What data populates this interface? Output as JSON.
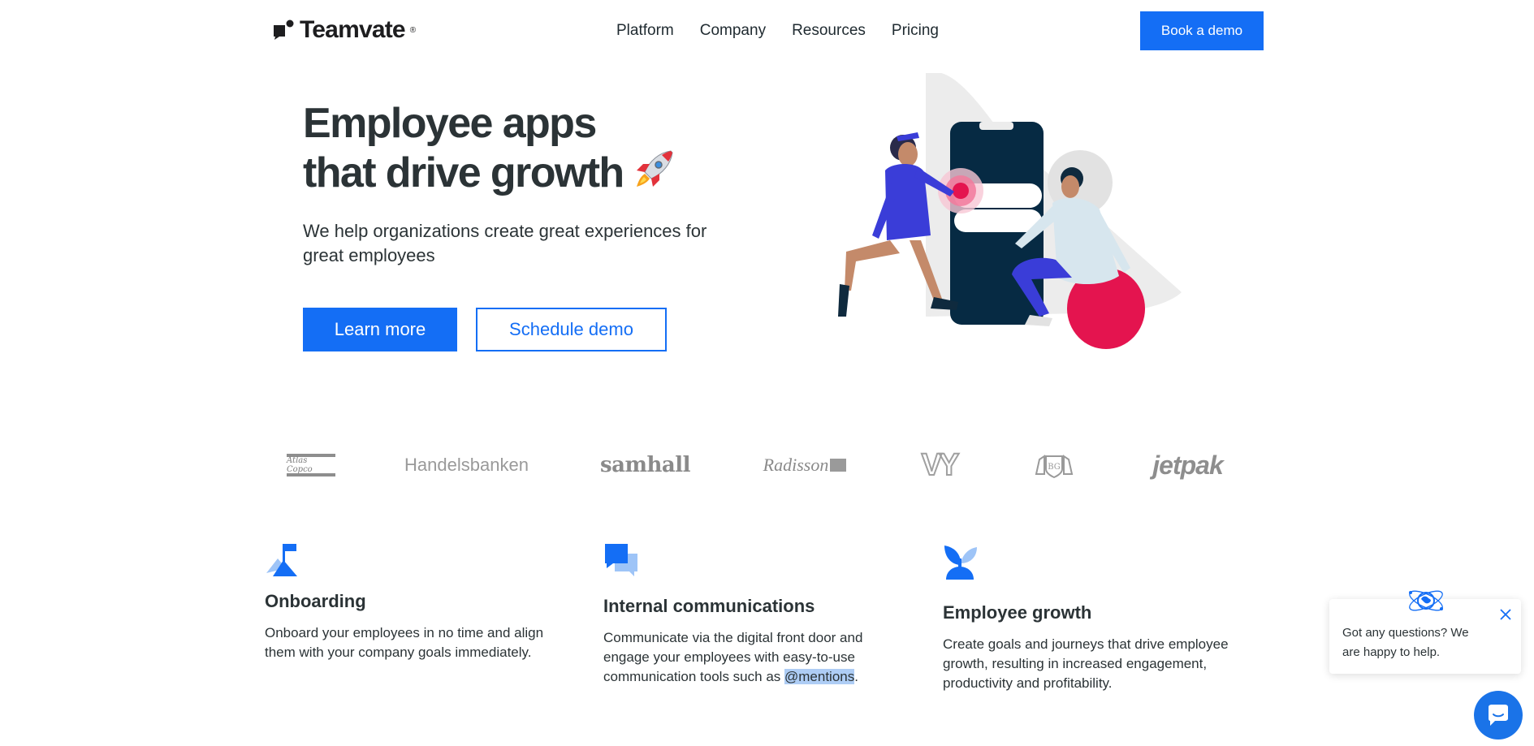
{
  "brand": {
    "name": "Teamvate",
    "reg": "®",
    "accent": "#146ef5"
  },
  "nav": {
    "items": [
      {
        "label": "Platform"
      },
      {
        "label": "Company"
      },
      {
        "label": "Resources"
      },
      {
        "label": "Pricing"
      }
    ],
    "cta_label": "Book a demo"
  },
  "hero": {
    "title_line1": "Employee apps",
    "title_line2": "that drive growth",
    "subtitle": "We help organizations create great experiences for great employees",
    "primary_label": "Learn more",
    "secondary_label": "Schedule demo",
    "illustration_icon": "people-with-phone-illustration",
    "emoji_icon": "rocket-icon"
  },
  "clients": {
    "atlas": "Atlas Copco",
    "handelsbanken": "Handelsbanken",
    "samhall": "samhall",
    "radisson": "Radisson",
    "vy": "VY",
    "crest_icon": "crest-logo",
    "jetpak": "jetpak"
  },
  "features": [
    {
      "icon": "flag-mountain-icon",
      "title": "Onboarding",
      "body": "Onboard your employees in no time and align them with your company goals immediately."
    },
    {
      "icon": "chat-bubbles-icon",
      "title": "Internal communications",
      "body_before": "Communicate via the digital front door and engage your employees with easy-to-use communication tools such as ",
      "body_highlight": "@mentions",
      "body_after": "."
    },
    {
      "icon": "plant-sprout-icon",
      "title": "Employee growth",
      "body": "Create goals and journeys that drive employee growth, resulting in increased engagement, productivity and profitability."
    }
  ],
  "chat": {
    "message": "Got any questions? We are happy to help.",
    "close_icon": "close-icon",
    "avatar_icon": "atom-globe-icon",
    "launcher_icon": "chat-icon"
  }
}
